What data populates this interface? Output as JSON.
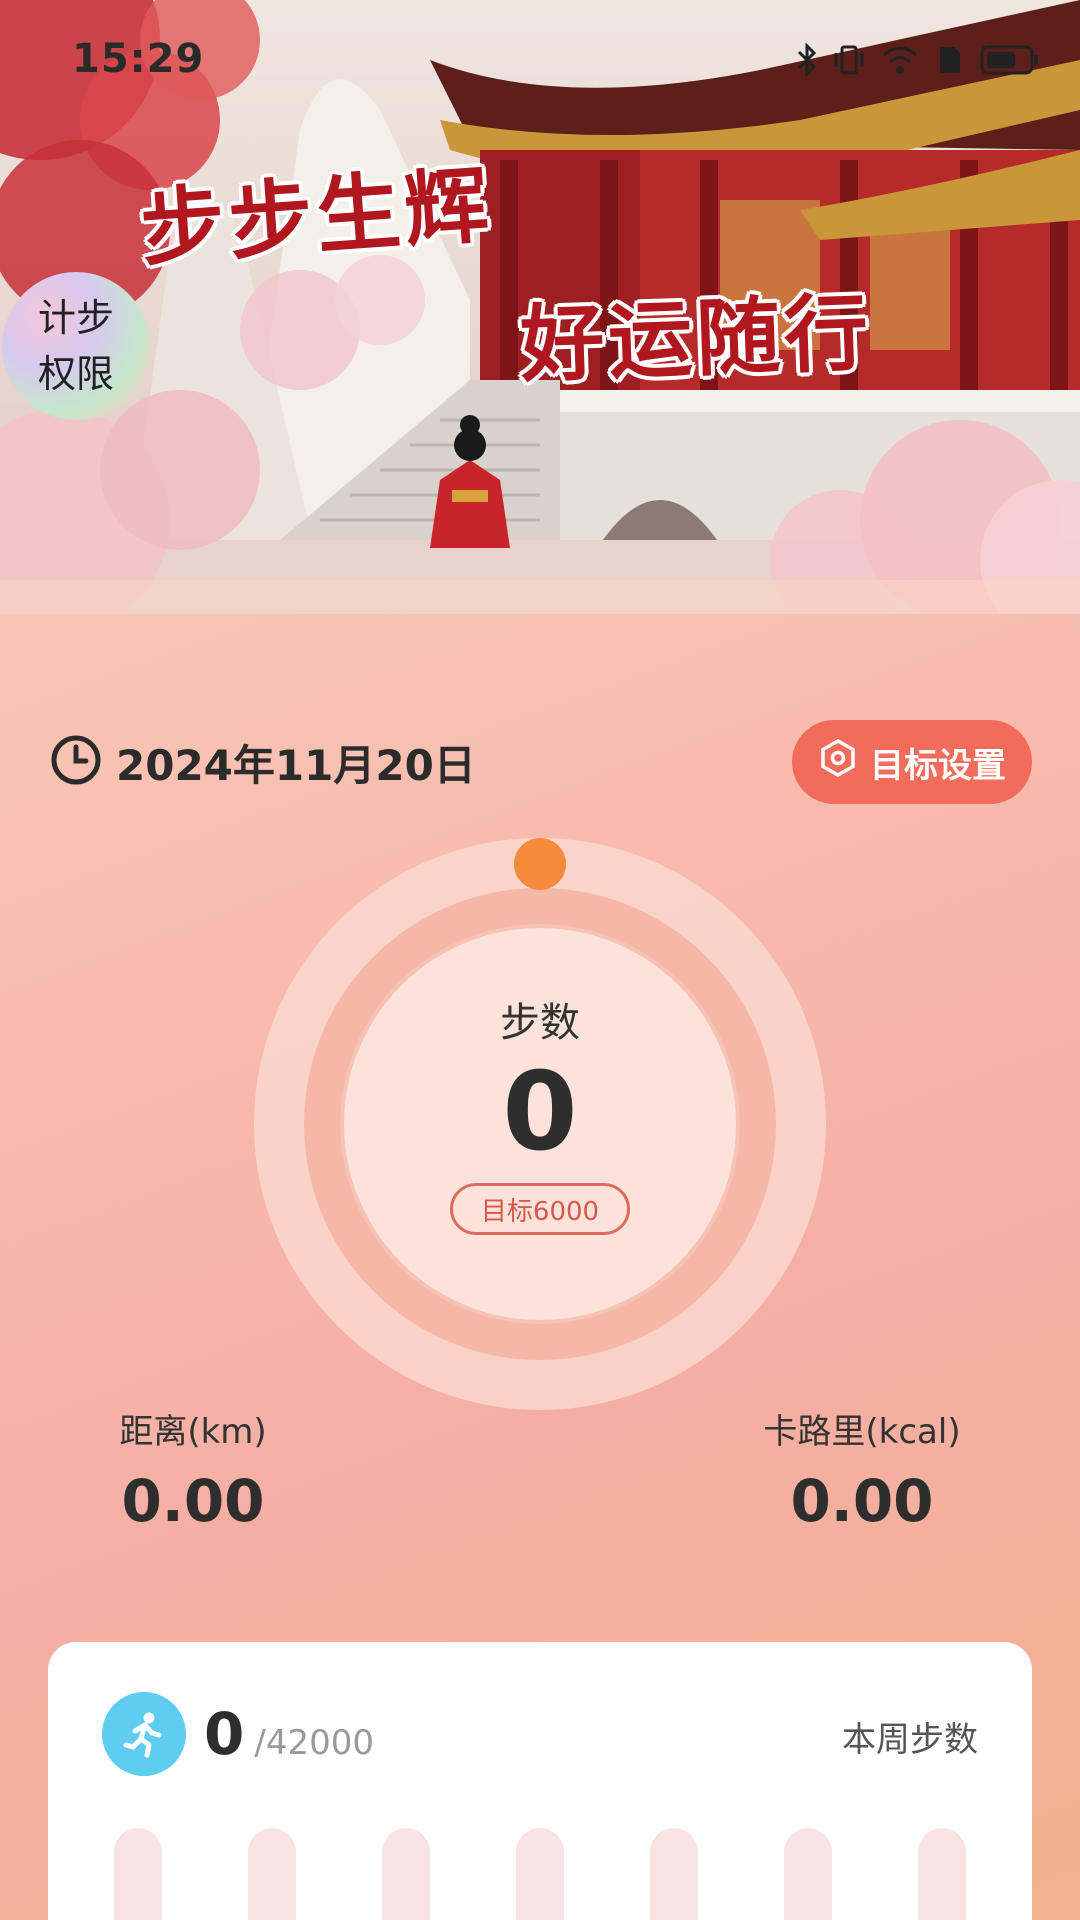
{
  "status_bar": {
    "time": "15:29",
    "icons": [
      "bluetooth-icon",
      "vibrate-icon",
      "wifi-icon",
      "sim-icon",
      "battery-icon"
    ]
  },
  "banner": {
    "title_line1": "步步生辉",
    "title_line2": "好运随行",
    "permission_line1": "计步",
    "permission_line2": "权限"
  },
  "header": {
    "date": "2024年11月20日",
    "goal_button_label": "目标设置"
  },
  "steps_ring": {
    "label": "步数",
    "value": "0",
    "goal_text": "目标6000",
    "progress": 0
  },
  "stats": {
    "distance_label": "距离(km)",
    "distance_value": "0.00",
    "calorie_label": "卡路里(kcal)",
    "calorie_value": "0.00"
  },
  "weekly": {
    "steps": "0",
    "total": "/42000",
    "label": "本周步数",
    "daily_values": [
      0,
      0,
      0,
      0,
      0,
      0,
      0
    ]
  },
  "colors": {
    "accent": "#f26b5b",
    "ring_dot": "#f58a3c",
    "run_icon_bg": "#5fcdef",
    "title_red": "#b0171f"
  }
}
